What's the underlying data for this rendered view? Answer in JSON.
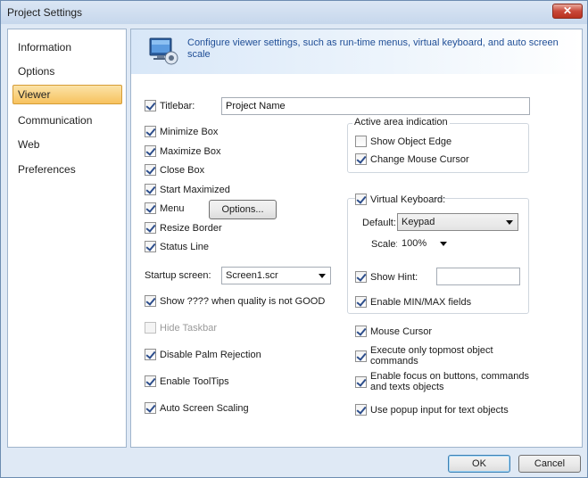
{
  "window": {
    "title": "Project Settings",
    "close_glyph": "✕"
  },
  "sidebar": {
    "items": [
      {
        "label": "Information",
        "selected": false
      },
      {
        "label": "Options",
        "selected": false
      },
      {
        "label": "Viewer",
        "selected": true
      },
      {
        "label": "Communication",
        "selected": false
      },
      {
        "label": "Web",
        "selected": false
      },
      {
        "label": "Preferences",
        "selected": false
      }
    ]
  },
  "header": {
    "icon": "viewer-settings-icon",
    "description": "Configure viewer settings, such as run-time menus, virtual keyboard, and auto screen scale"
  },
  "left": {
    "titlebar": {
      "label": "Titlebar:",
      "checked": true,
      "value": "Project Name"
    },
    "minimize_box": {
      "label": "Minimize Box",
      "checked": true
    },
    "maximize_box": {
      "label": "Maximize Box",
      "checked": true
    },
    "close_box": {
      "label": "Close Box",
      "checked": true
    },
    "start_maximized": {
      "label": "Start Maximized",
      "checked": true
    },
    "menu": {
      "label": "Menu",
      "checked": true,
      "button": "Options..."
    },
    "resize_border": {
      "label": "Resize Border",
      "checked": true
    },
    "status_line": {
      "label": "Status Line",
      "checked": true
    },
    "startup_screen": {
      "label": "Startup screen:",
      "value": "Screen1.scr"
    },
    "show_quality": {
      "label": "Show ???? when quality is not GOOD",
      "checked": true
    },
    "hide_taskbar": {
      "label": "Hide Taskbar",
      "checked": false,
      "disabled": true
    },
    "disable_palm": {
      "label": "Disable Palm Rejection",
      "checked": true
    },
    "enable_tooltips": {
      "label": "Enable ToolTips",
      "checked": true
    },
    "auto_screen_scaling": {
      "label": "Auto Screen Scaling",
      "checked": true
    }
  },
  "right": {
    "active_area": {
      "title": "Active area indication",
      "show_object_edge": {
        "label": "Show Object Edge",
        "checked": false
      },
      "change_mouse_cursor": {
        "label": "Change Mouse Cursor",
        "checked": true
      }
    },
    "virtual_keyboard": {
      "label": "Virtual Keyboard:",
      "checked": true,
      "default_label": "Default:",
      "default_value": "Keypad",
      "scale_label": "Scale:",
      "scale_value": "100%",
      "show_hint": {
        "label": "Show Hint:",
        "checked": true,
        "value": ""
      },
      "enable_minmax": {
        "label": "Enable MIN/MAX fields",
        "checked": true
      }
    },
    "mouse_cursor": {
      "label": "Mouse Cursor",
      "checked": true
    },
    "execute_topmost": {
      "label": "Execute only topmost object commands",
      "checked": true
    },
    "enable_focus": {
      "label": "Enable focus on buttons, commands and texts objects",
      "checked": true
    },
    "popup_input": {
      "label": "Use popup input for text objects",
      "checked": true
    }
  },
  "footer": {
    "ok_label": "OK",
    "cancel_label": "Cancel"
  }
}
